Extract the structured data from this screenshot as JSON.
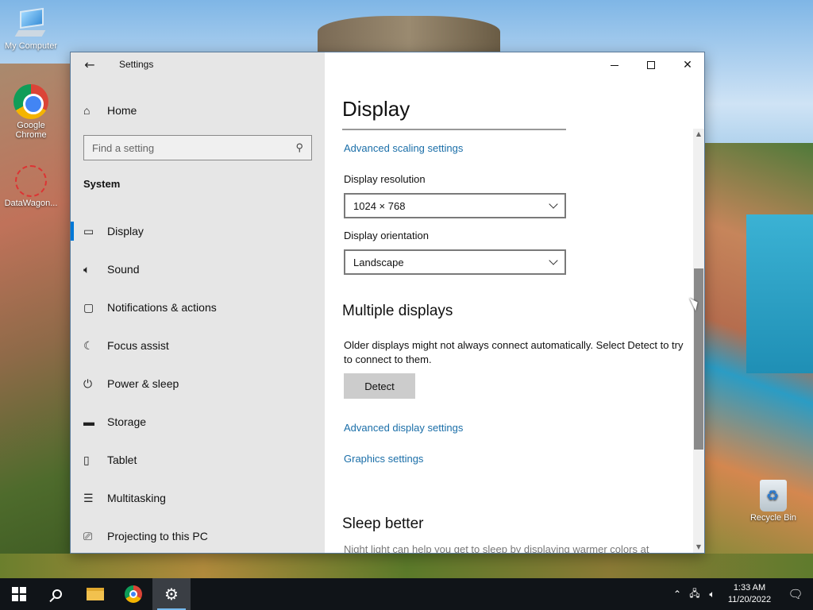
{
  "desktop": {
    "icons": [
      {
        "label": "My Computer"
      },
      {
        "label": "Google Chrome"
      },
      {
        "label": "DataWagon..."
      },
      {
        "label": "Recycle Bin"
      }
    ]
  },
  "window": {
    "title": "Settings",
    "back_icon": "back-arrow-icon",
    "controls": {
      "minimize": "minimize",
      "maximize": "maximize",
      "close": "close"
    }
  },
  "sidebar": {
    "home_label": "Home",
    "search_placeholder": "Find a setting",
    "section_label": "System",
    "items": [
      {
        "label": "Display",
        "icon": "monitor-icon",
        "selected": true
      },
      {
        "label": "Sound",
        "icon": "speaker-icon"
      },
      {
        "label": "Notifications & actions",
        "icon": "notification-icon"
      },
      {
        "label": "Focus assist",
        "icon": "moon-icon"
      },
      {
        "label": "Power & sleep",
        "icon": "power-icon"
      },
      {
        "label": "Storage",
        "icon": "storage-icon"
      },
      {
        "label": "Tablet",
        "icon": "tablet-icon"
      },
      {
        "label": "Multitasking",
        "icon": "multitasking-icon"
      },
      {
        "label": "Projecting to this PC",
        "icon": "projector-icon"
      }
    ]
  },
  "content": {
    "title": "Display",
    "advanced_scaling_link": "Advanced scaling settings",
    "resolution_label": "Display resolution",
    "resolution_value": "1024 × 768",
    "orientation_label": "Display orientation",
    "orientation_value": "Landscape",
    "multiple_displays_heading": "Multiple displays",
    "multiple_displays_text": "Older displays might not always connect automatically. Select Detect to try to connect to them.",
    "detect_button": "Detect",
    "advanced_display_link": "Advanced display settings",
    "graphics_link": "Graphics settings",
    "sleep_heading": "Sleep better",
    "sleep_text": "Night light can help you get to sleep by displaying warmer colors at"
  },
  "taskbar": {
    "time": "1:33 AM",
    "date": "11/20/2022"
  },
  "colors": {
    "accent": "#0078d7",
    "link": "#1a6ea8",
    "sidebar_bg": "#e6e6e6",
    "taskbar_bg": "#101418"
  }
}
